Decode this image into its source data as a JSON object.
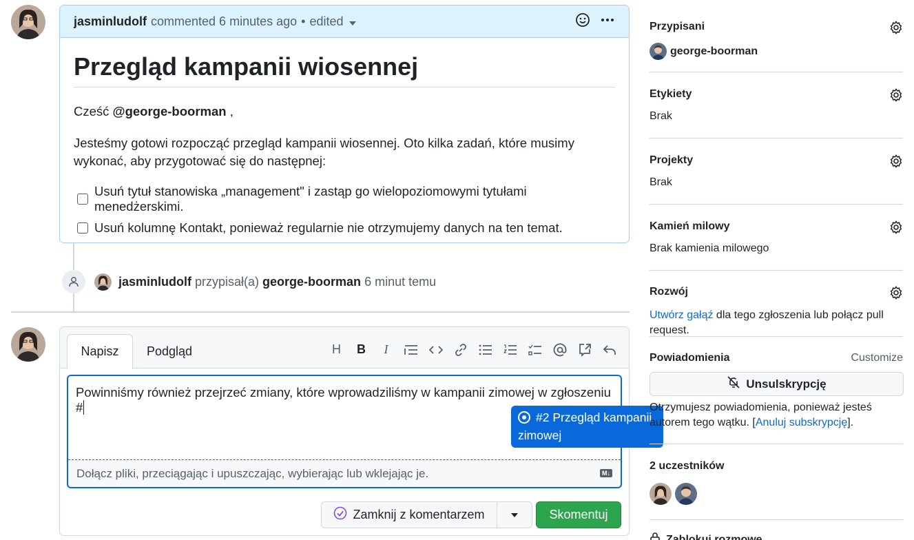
{
  "comment": {
    "author": "jasminludolf",
    "meta": "commented 6 minutes ago",
    "edited": "edited",
    "title": "Przegląd kampanii wiosennej",
    "greeting_prefix": "Cześć",
    "greeting_mention": "@george-boorman",
    "greeting_suffix": ",",
    "intro": "Jesteśmy gotowi rozpocząć przegląd kampanii wiosennej. Oto kilka zadań, które musimy wykonać, aby przygotować się do następnej:",
    "tasks": [
      {
        "label": "Usuń tytuł stanowiska „management\" i zastąp go wielopoziomowymi tytułami menedżerskimi.",
        "checked": false
      },
      {
        "label": "Usuń kolumnę Kontakt, ponieważ regularnie nie otrzymujemy danych na ten temat.",
        "checked": false
      }
    ]
  },
  "event": {
    "actor": "jasminludolf",
    "action": "przypisał(a)",
    "target": "george-boorman",
    "time": "6 minut temu"
  },
  "editor": {
    "tab_write": "Napisz",
    "tab_preview": "Podgląd",
    "text": "Powinniśmy również przejrzeć zmiany, które wprowadziliśmy w kampanii zimowej w zgłoszeniu #",
    "attach_hint": "Dołącz pliki, przeciągając i upuszczając, wybierając lub wklejając je.",
    "md_badge": "M↓",
    "suggestion": "#2 Przegląd kampanii zimowej",
    "close_label": "Zamknij z komentarzem",
    "comment_label": "Skomentuj"
  },
  "sidebar": {
    "assignees_title": "Przypisani",
    "assignee": "george-boorman",
    "labels_title": "Etykiety",
    "labels_value": "Brak",
    "projects_title": "Projekty",
    "projects_value": "Brak",
    "milestone_title": "Kamień milowy",
    "milestone_value": "Brak kamienia milowego",
    "dev_title": "Rozwój",
    "dev_link": "Utwórz gałąź",
    "dev_text": " dla tego zgłoszenia lub połącz pull request.",
    "notif_title": "Powiadomienia",
    "notif_customize": "Customize",
    "unsubscribe": "Unsulskrypcję",
    "notif_text_1": "Otrzymujesz powiadomienia, ponieważ jesteś autorem tego wątku. [",
    "notif_link": "Anuluj subskrypcję",
    "notif_text_2": "].",
    "participants_title": "2 uczestników",
    "lock": "Zablokuj rozmowę"
  },
  "colors": {
    "accent": "#0969da",
    "success": "#2da44e",
    "header_bg": "#ddf4ff"
  }
}
